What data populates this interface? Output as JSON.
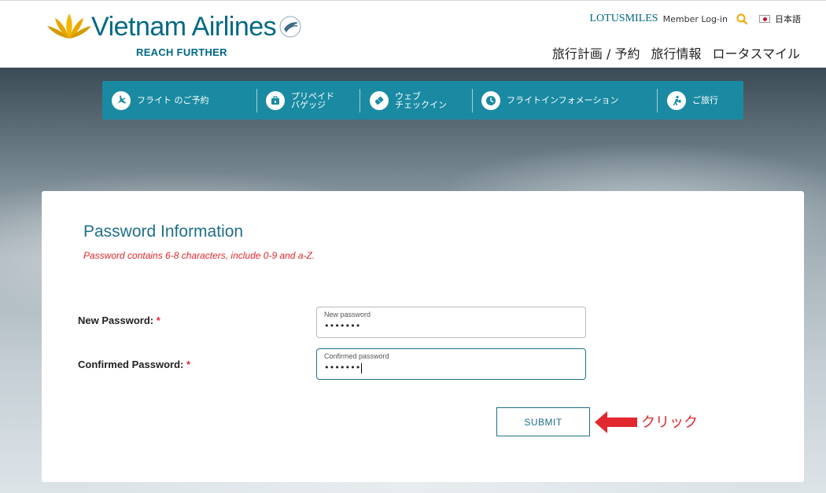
{
  "brand": {
    "name": "Vietnam Airlines",
    "tagline": "REACH FURTHER"
  },
  "topbar": {
    "program": "LOTUSMILES",
    "login": "Member Log-in",
    "language": "日本語"
  },
  "mainnav": {
    "items": [
      "旅行計画 / 予約",
      "旅行情報",
      "ロータスマイル"
    ]
  },
  "servicenav": {
    "items": [
      {
        "label": "フライト のご予約",
        "icon": "plane-icon"
      },
      {
        "label": "プリペイド\nバゲッジ",
        "icon": "baggage-icon"
      },
      {
        "label": "ウェブ\nチェックイン",
        "icon": "ticket-icon"
      },
      {
        "label": "フライトインフォメーション",
        "icon": "clock-icon"
      },
      {
        "label": "ご旅行",
        "icon": "traveler-icon"
      }
    ]
  },
  "form": {
    "title": "Password Information",
    "hint": "Password contains 6-8 characters, include 0-9 and a-Z.",
    "new_password": {
      "label": "New Password:",
      "placeholder": "New password",
      "value": "•••••••"
    },
    "confirmed_password": {
      "label": "Confirmed Password:",
      "placeholder": "Confirmed password",
      "value": "•••••••"
    },
    "required_mark": "*",
    "submit_label": "SUBMIT"
  },
  "annotation": {
    "label": "クリック",
    "color": "#e0282e"
  },
  "colors": {
    "brand": "#006885",
    "nav": "#1a8aa2",
    "accent": "#e0282e"
  }
}
